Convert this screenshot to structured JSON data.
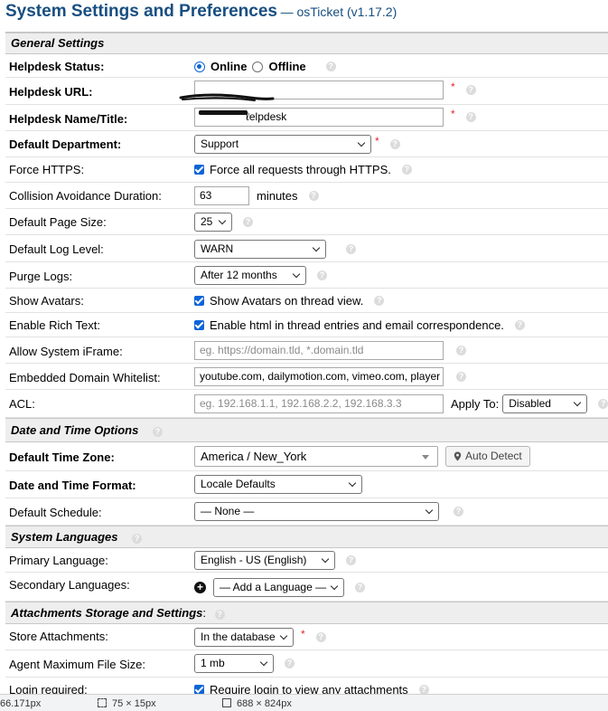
{
  "page": {
    "title": "System Settings and Preferences",
    "subtitle": "— osTicket (v1.17.2)"
  },
  "sections": {
    "general": "General Settings",
    "datetime": "Date and Time Options",
    "languages": "System Languages",
    "attachments": "Attachments Storage and Settings",
    "attachments_colon": ":"
  },
  "general": {
    "helpdesk_status": {
      "label": "Helpdesk Status:",
      "online": "Online",
      "offline": "Offline"
    },
    "helpdesk_url": {
      "label": "Helpdesk URL:",
      "value": ""
    },
    "helpdesk_name": {
      "label": "Helpdesk Name/Title:",
      "value": "ℓelpdesk"
    },
    "default_department": {
      "label": "Default Department:",
      "value": "Support"
    },
    "force_https": {
      "label": "Force HTTPS:",
      "text": "Force all requests through HTTPS."
    },
    "collision": {
      "label": "Collision Avoidance Duration:",
      "value": "63",
      "unit": "minutes"
    },
    "page_size": {
      "label": "Default Page Size:",
      "value": "25"
    },
    "log_level": {
      "label": "Default Log Level:",
      "value": "WARN"
    },
    "purge_logs": {
      "label": "Purge Logs:",
      "value": "After 12 months"
    },
    "show_avatars": {
      "label": "Show Avatars:",
      "text": "Show Avatars on thread view."
    },
    "rich_text": {
      "label": "Enable Rich Text:",
      "text": "Enable html in thread entries and email correspondence."
    },
    "iframe": {
      "label": "Allow System iFrame:",
      "placeholder": "eg. https://domain.tld, *.domain.tld"
    },
    "embedded": {
      "label": "Embedded Domain Whitelist:",
      "value": "youtube.com, dailymotion.com, vimeo.com, player"
    },
    "acl": {
      "label": "ACL:",
      "placeholder": "eg. 192.168.1.1, 192.168.2.2, 192.168.3.3",
      "apply_label": "Apply To:",
      "apply_value": "Disabled"
    }
  },
  "datetime": {
    "timezone": {
      "label": "Default Time Zone:",
      "value": "America / New_York",
      "auto_detect": "Auto Detect"
    },
    "format": {
      "label": "Date and Time Format:",
      "value": "Locale Defaults"
    },
    "schedule": {
      "label": "Default Schedule:",
      "value": "— None —"
    }
  },
  "languages": {
    "primary": {
      "label": "Primary Language:",
      "value": "English - US (English)"
    },
    "secondary": {
      "label": "Secondary Languages:",
      "value": "— Add a Language —"
    }
  },
  "attachments": {
    "store": {
      "label": "Store Attachments:",
      "value": "In the database"
    },
    "max_size": {
      "label": "Agent Maximum File Size:",
      "value": "1 mb"
    },
    "login_required": {
      "label": "Login required:",
      "text": "Require login to view any attachments"
    }
  },
  "help_glyph": "?",
  "required_glyph": "*",
  "devtools": {
    "cursor": "66.171px",
    "selection": "75 × 15px",
    "viewport": "688 × 824px"
  },
  "colors": {
    "title": "#184e81",
    "accent": "#0b64d8",
    "required": "#e0262e"
  }
}
